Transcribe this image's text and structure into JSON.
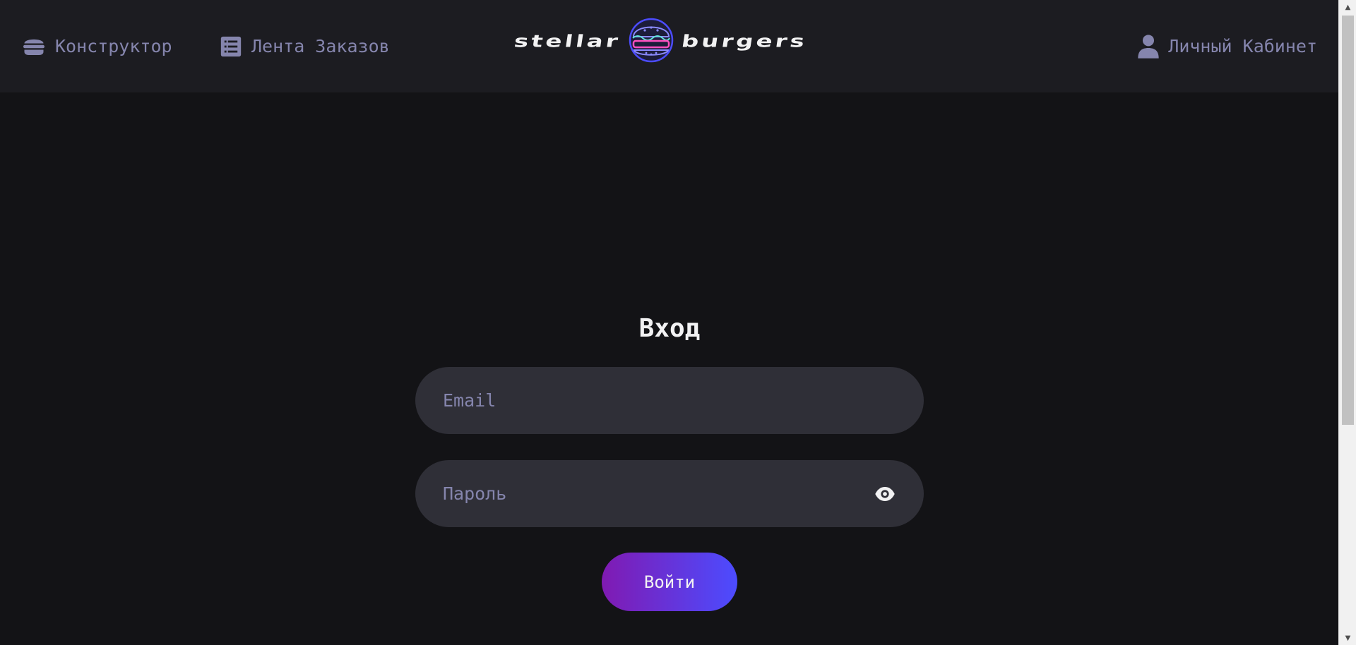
{
  "header": {
    "nav": {
      "constructor_label": "Конструктор",
      "feed_label": "Лента Заказов",
      "profile_label": "Личный Кабинет"
    },
    "logo": {
      "word_left": "stellar",
      "word_right": "burgers"
    }
  },
  "login_form": {
    "title": "Вход",
    "email_placeholder": "Email",
    "email_value": "",
    "password_placeholder": "Пароль",
    "password_value": "",
    "submit_label": "Войти"
  },
  "colors": {
    "background": "#131316",
    "header_background": "#1c1c21",
    "input_background": "#2f2f37",
    "inactive_text": "#8585ad",
    "primary_text": "#f2f2f3",
    "button_gradient_start": "#801ab2",
    "button_gradient_end": "#4c4cff"
  },
  "icons": {
    "constructor": "burger-icon",
    "feed": "list-icon",
    "profile": "profile-icon",
    "password_toggle": "eye-icon",
    "logo": "burger-logo-icon"
  }
}
